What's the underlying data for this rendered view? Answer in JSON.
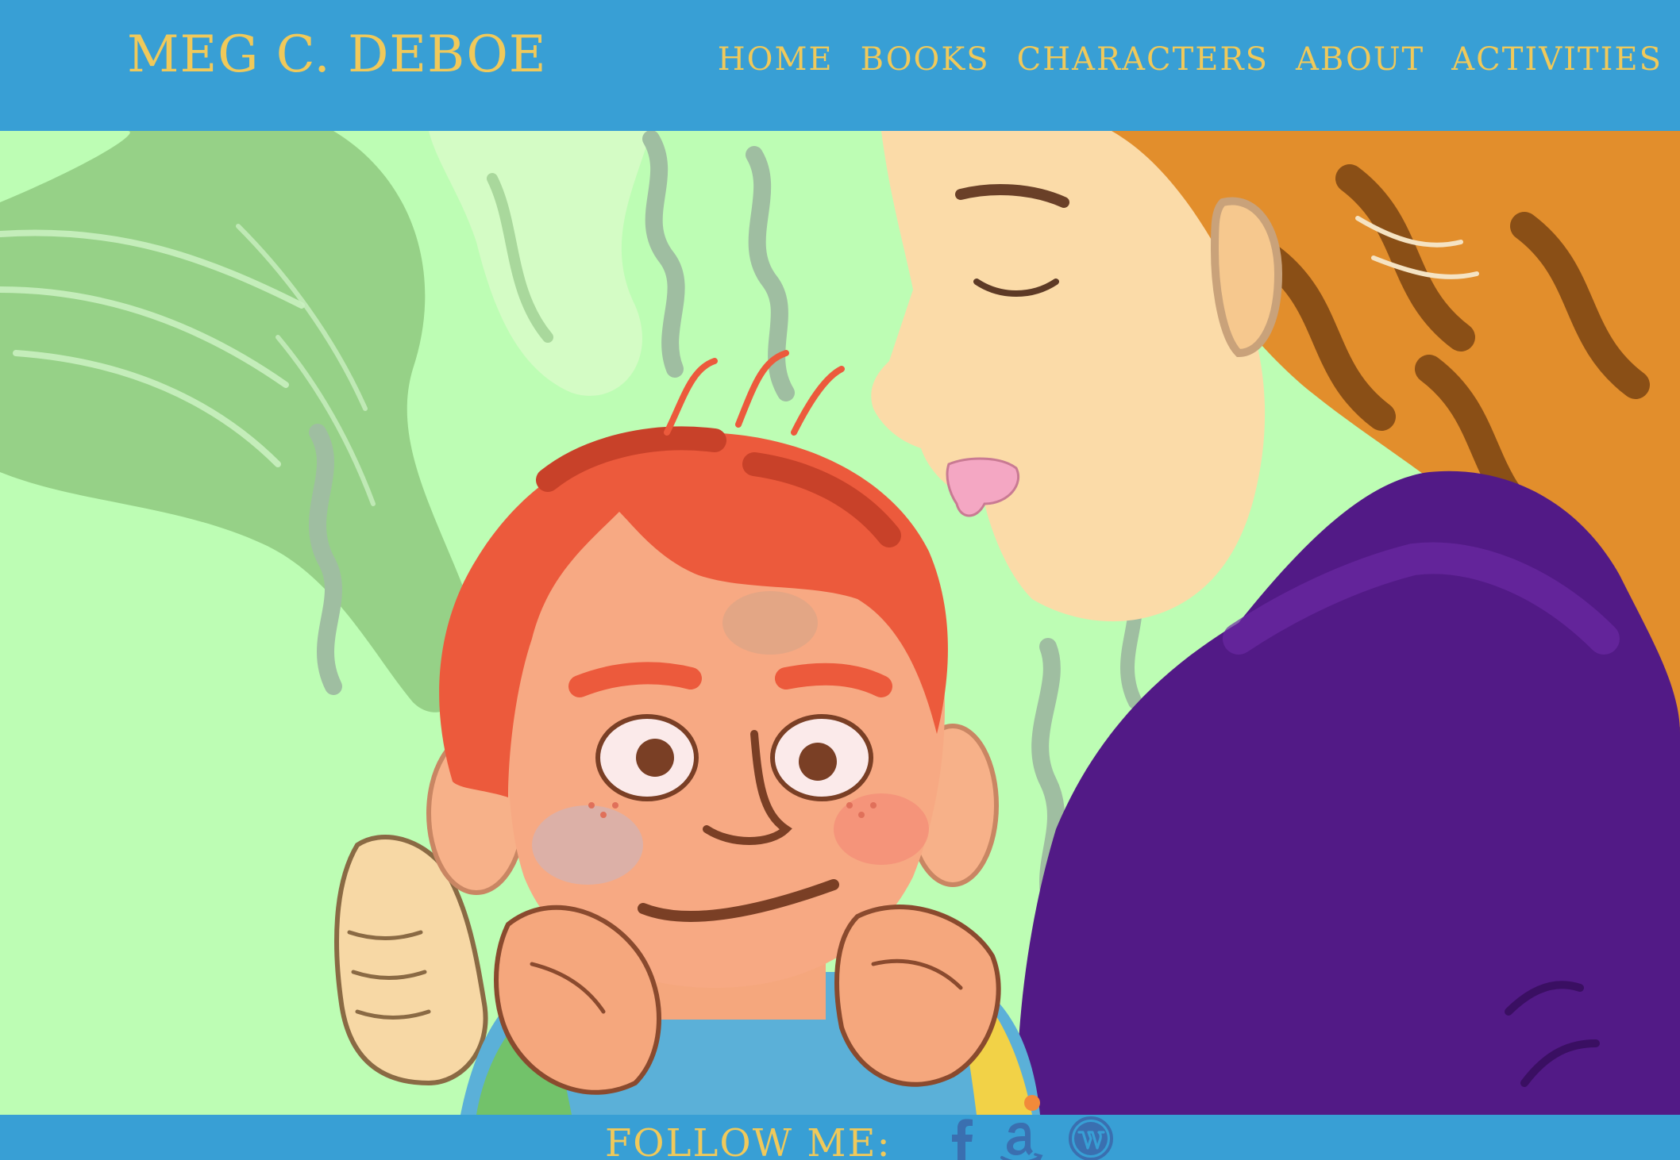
{
  "site": {
    "title": "MEG C. DEBOE"
  },
  "nav": {
    "items": [
      {
        "label": "HOME"
      },
      {
        "label": "BOOKS"
      },
      {
        "label": "CHARACTERS"
      },
      {
        "label": "ABOUT"
      },
      {
        "label": "ACTIVITIES"
      }
    ]
  },
  "hero": {
    "icon": "illustration-boy-and-woman"
  },
  "footer": {
    "follow_label": "FOLLOW ME:",
    "social": [
      {
        "icon": "facebook-icon"
      },
      {
        "icon": "amazon-icon"
      },
      {
        "icon": "wordpress-icon"
      }
    ]
  },
  "colors": {
    "brand_blue": "#389fd5",
    "brand_gold": "#f0c95a",
    "hero_background": "#bdfdb4",
    "social_icon": "#3a6fb0"
  }
}
